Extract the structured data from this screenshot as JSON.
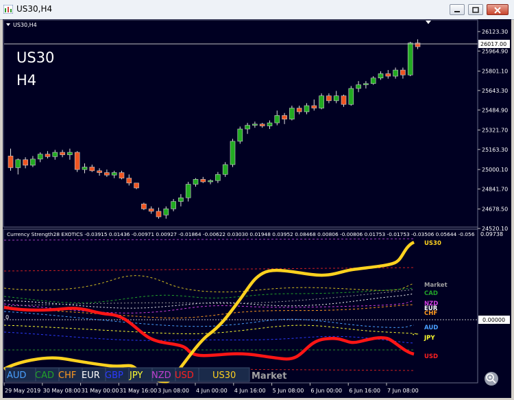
{
  "window": {
    "title": "US30,H4",
    "controls": [
      "minimize",
      "restore",
      "close"
    ]
  },
  "main_chart": {
    "header": "US30,H4",
    "symbol_label": "US30",
    "timeframe_label": "H4",
    "current_price": "26017.00",
    "price_scale": [
      "26123.30",
      "25964.90",
      "25801.10",
      "25643.30",
      "25484.90",
      "25321.70",
      "25163.30",
      "25000.10",
      "24841.70",
      "24678.50",
      "24520.10"
    ],
    "candles": [
      {
        "o": 25110,
        "h": 25170,
        "l": 24990,
        "c": 25015
      },
      {
        "o": 25015,
        "h": 25090,
        "l": 24960,
        "c": 25080
      },
      {
        "o": 25080,
        "h": 25100,
        "l": 25010,
        "c": 25035
      },
      {
        "o": 25035,
        "h": 25110,
        "l": 25020,
        "c": 25085
      },
      {
        "o": 25085,
        "h": 25140,
        "l": 25060,
        "c": 25125
      },
      {
        "o": 25125,
        "h": 25150,
        "l": 25090,
        "c": 25105
      },
      {
        "o": 25105,
        "h": 25160,
        "l": 25080,
        "c": 25140
      },
      {
        "o": 25140,
        "h": 25160,
        "l": 25100,
        "c": 25120
      },
      {
        "o": 25120,
        "h": 25170,
        "l": 25080,
        "c": 25140
      },
      {
        "o": 25140,
        "h": 25150,
        "l": 24980,
        "c": 25000
      },
      {
        "o": 25000,
        "h": 25050,
        "l": 24970,
        "c": 25020
      },
      {
        "o": 25020,
        "h": 25040,
        "l": 24980,
        "c": 24990
      },
      {
        "o": 24990,
        "h": 25010,
        "l": 24950,
        "c": 24975
      },
      {
        "o": 24975,
        "h": 25000,
        "l": 24940,
        "c": 24955
      },
      {
        "o": 24955,
        "h": 24990,
        "l": 24930,
        "c": 24975
      },
      {
        "o": 24975,
        "h": 24990,
        "l": 24920,
        "c": 24930
      },
      {
        "o": 24930,
        "h": 24960,
        "l": 24870,
        "c": 24890
      },
      {
        "o": 24890,
        "h": 24880,
        "l": 24840,
        "c": 24850
      },
      {
        "o": 24720,
        "h": 24730,
        "l": 24670,
        "c": 24680
      },
      {
        "o": 24680,
        "h": 24700,
        "l": 24640,
        "c": 24660
      },
      {
        "o": 24660,
        "h": 24690,
        "l": 24600,
        "c": 24615
      },
      {
        "o": 24630,
        "h": 24700,
        "l": 24600,
        "c": 24680
      },
      {
        "o": 24680,
        "h": 24760,
        "l": 24660,
        "c": 24740
      },
      {
        "o": 24740,
        "h": 24800,
        "l": 24700,
        "c": 24770
      },
      {
        "o": 24770,
        "h": 24900,
        "l": 24740,
        "c": 24880
      },
      {
        "o": 24880,
        "h": 24930,
        "l": 24860,
        "c": 24920
      },
      {
        "o": 24920,
        "h": 24940,
        "l": 24890,
        "c": 24900
      },
      {
        "o": 24900,
        "h": 24920,
        "l": 24880,
        "c": 24910
      },
      {
        "o": 24910,
        "h": 24980,
        "l": 24890,
        "c": 24960
      },
      {
        "o": 24960,
        "h": 25060,
        "l": 24940,
        "c": 25040
      },
      {
        "o": 25040,
        "h": 25250,
        "l": 25020,
        "c": 25230
      },
      {
        "o": 25230,
        "h": 25350,
        "l": 25210,
        "c": 25330
      },
      {
        "o": 25330,
        "h": 25380,
        "l": 25290,
        "c": 25360
      },
      {
        "o": 25360,
        "h": 25390,
        "l": 25340,
        "c": 25370
      },
      {
        "o": 25370,
        "h": 25380,
        "l": 25340,
        "c": 25355
      },
      {
        "o": 25355,
        "h": 25400,
        "l": 25330,
        "c": 25380
      },
      {
        "o": 25380,
        "h": 25480,
        "l": 25360,
        "c": 25440
      },
      {
        "o": 25440,
        "h": 25460,
        "l": 25370,
        "c": 25410
      },
      {
        "o": 25410,
        "h": 25520,
        "l": 25400,
        "c": 25500
      },
      {
        "o": 25500,
        "h": 25520,
        "l": 25450,
        "c": 25470
      },
      {
        "o": 25470,
        "h": 25540,
        "l": 25450,
        "c": 25520
      },
      {
        "o": 25520,
        "h": 25570,
        "l": 25480,
        "c": 25500
      },
      {
        "o": 25500,
        "h": 25620,
        "l": 25490,
        "c": 25600
      },
      {
        "o": 25600,
        "h": 25620,
        "l": 25540,
        "c": 25560
      },
      {
        "o": 25560,
        "h": 25640,
        "l": 25540,
        "c": 25600
      },
      {
        "o": 25600,
        "h": 25610,
        "l": 25510,
        "c": 25530
      },
      {
        "o": 25530,
        "h": 25680,
        "l": 25520,
        "c": 25660
      },
      {
        "o": 25660,
        "h": 25720,
        "l": 25630,
        "c": 25690
      },
      {
        "o": 25690,
        "h": 25720,
        "l": 25660,
        "c": 25700
      },
      {
        "o": 25700,
        "h": 25760,
        "l": 25690,
        "c": 25745
      },
      {
        "o": 25745,
        "h": 25800,
        "l": 25730,
        "c": 25780
      },
      {
        "o": 25780,
        "h": 25810,
        "l": 25740,
        "c": 25760
      },
      {
        "o": 25760,
        "h": 25830,
        "l": 25740,
        "c": 25810
      },
      {
        "o": 25810,
        "h": 25830,
        "l": 25740,
        "c": 25770
      },
      {
        "o": 25770,
        "h": 26040,
        "l": 25760,
        "c": 26030
      },
      {
        "o": 26030,
        "h": 26060,
        "l": 25980,
        "c": 26000
      }
    ]
  },
  "indicator": {
    "header": "Currency Strength28 EXOTICS  -0.03915 0.01436 -0.00971 0.00927 -0.01864 -0.00622 0.03030 0.01948 0.03952 0.08468 0.00806 -0.00806 0.01753 -0.01753 -0.03506 0.05644 -0.056",
    "top_scale": "0.09738",
    "zero_scale": "0.00000",
    "zero_label": "0",
    "right_labels": [
      {
        "text": "US30",
        "color": "#ffd21f"
      },
      {
        "text": "Market",
        "color": "#a0a0a0"
      },
      {
        "text": "CAD",
        "color": "#22a22a"
      },
      {
        "text": "NZD",
        "color": "#d040e0"
      },
      {
        "text": "EUR",
        "color": "#ffffff"
      },
      {
        "text": "CHF",
        "color": "#ff9a20"
      },
      {
        "text": "AUD",
        "color": "#4aa0ff"
      },
      {
        "text": "JPY",
        "color": "#ffff30"
      },
      {
        "text": "USD",
        "color": "#ff2020"
      }
    ],
    "legend": [
      {
        "text": "AUD",
        "color": "#4aa0ff"
      },
      {
        "text": "CAD",
        "color": "#22a22a"
      },
      {
        "text": "CHF",
        "color": "#ff9a20"
      },
      {
        "text": "EUR",
        "color": "#ffffff"
      },
      {
        "text": "GBP",
        "color": "#2a3aff"
      },
      {
        "text": "JPY",
        "color": "#ffff30"
      },
      {
        "text": "NZD",
        "color": "#c040d0"
      },
      {
        "text": "USD",
        "color": "#ff2020"
      },
      {
        "text": "US30",
        "color": "#ffd21f"
      },
      {
        "text": "Market",
        "color": "#a0a0a0"
      }
    ]
  },
  "time_axis": [
    "29 May 2019",
    "30 May 08:00",
    "31 May 00:00",
    "31 May 16:00",
    "3 Jun 08:00",
    "4 Jun 00:00",
    "4 Jun 16:00",
    "5 Jun 08:00",
    "6 Jun 00:00",
    "6 Jun 16:00",
    "7 Jun 08:00"
  ],
  "colors": {
    "background": "#000022",
    "bull": "#22aa22",
    "bear": "#ee5522"
  }
}
